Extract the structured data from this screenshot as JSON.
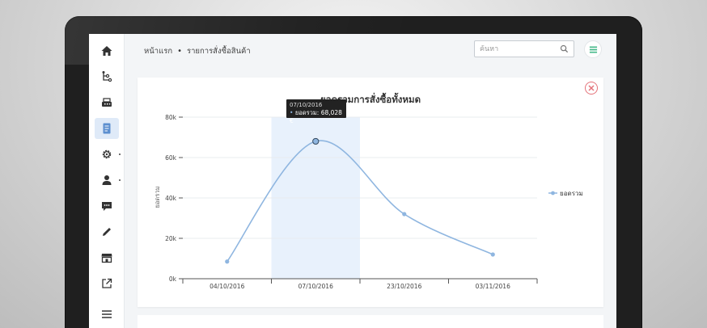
{
  "breadcrumb": {
    "home": "หน้าแรก",
    "separator": "•",
    "current": "รายการสั่งซื้อสินค้า"
  },
  "search": {
    "placeholder": "ค้นหา"
  },
  "sidebar": {
    "items": [
      {
        "icon": "home-icon"
      },
      {
        "icon": "sitemap-icon"
      },
      {
        "icon": "cash-register-icon"
      },
      {
        "icon": "document-icon",
        "active": true
      },
      {
        "icon": "gear-icon",
        "has_submenu": true
      },
      {
        "icon": "user-icon",
        "has_submenu": true
      },
      {
        "icon": "chat-icon"
      },
      {
        "icon": "pencil-icon"
      },
      {
        "icon": "store-icon"
      },
      {
        "icon": "external-link-icon"
      },
      {
        "icon": "hamburger-icon"
      }
    ]
  },
  "colors": {
    "accent": "#8fb6e0",
    "highlight": "#e8f1fc",
    "close": "#e4737a",
    "menu_icon": "#46b98a"
  },
  "tooltip": {
    "date": "07/10/2016",
    "bullet": "•",
    "label": "ยอดรวม:",
    "value": "68,028 €"
  },
  "chart_data": {
    "type": "line",
    "title": "ยอดรวมการสั่งซื้อทั้งหมด",
    "ylabel": "ยอดรวม",
    "xlabel": "",
    "x": [
      "04/10/2016",
      "07/10/2016",
      "23/10/2016",
      "03/11/2016"
    ],
    "series": [
      {
        "name": "ยอดรวม",
        "values": [
          8500,
          68028,
          32000,
          12000
        ]
      }
    ],
    "ylim": [
      0,
      80000
    ],
    "yticks": [
      "0k",
      "20k",
      "40k",
      "60k",
      "80k"
    ],
    "highlight_index": 1,
    "grid": true,
    "legend": "right"
  }
}
